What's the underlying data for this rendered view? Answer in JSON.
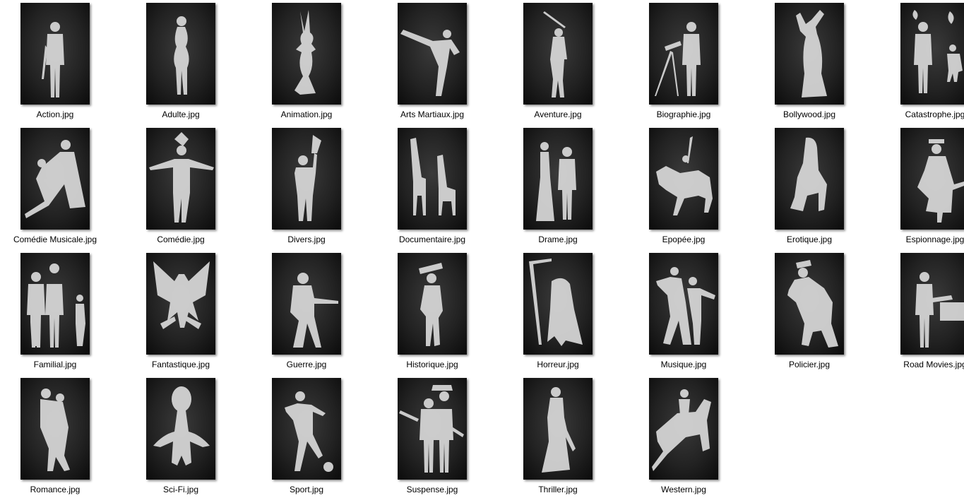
{
  "colors": {
    "background": "#ffffff",
    "thumbnail_dark": "#1c1c1c",
    "silhouette": "#d9d9d9",
    "label_text": "#000000"
  },
  "files": [
    {
      "name": "Action.jpg",
      "icon": "suited-man-silhouette-icon"
    },
    {
      "name": "Adulte.jpg",
      "icon": "woman-silhouette-icon"
    },
    {
      "name": "Animation.jpg",
      "icon": "cartoon-rabbit-silhouette-icon"
    },
    {
      "name": "Arts Martiaux.jpg",
      "icon": "karate-kick-silhouette-icon"
    },
    {
      "name": "Aventure.jpg",
      "icon": "swashbuckler-silhouette-icon"
    },
    {
      "name": "Biographie.jpg",
      "icon": "man-with-telescope-silhouette-icon"
    },
    {
      "name": "Bollywood.jpg",
      "icon": "dancer-silhouette-icon"
    },
    {
      "name": "Catastrophe.jpg",
      "icon": "fleeing-people-silhouette-icon"
    },
    {
      "name": "Comédie Musicale.jpg",
      "icon": "dancing-couple-silhouette-icon"
    },
    {
      "name": "Comédie.jpg",
      "icon": "jester-silhouette-icon"
    },
    {
      "name": "Divers.jpg",
      "icon": "man-raising-object-silhouette-icon"
    },
    {
      "name": "Documentaire.jpg",
      "icon": "giraffes-silhouette-icon"
    },
    {
      "name": "Drame.jpg",
      "icon": "couple-standing-silhouette-icon"
    },
    {
      "name": "Epopée.jpg",
      "icon": "knight-on-horse-silhouette-icon"
    },
    {
      "name": "Erotique.jpg",
      "icon": "crouching-woman-silhouette-icon"
    },
    {
      "name": "Espionnage.jpg",
      "icon": "spy-with-gun-silhouette-icon"
    },
    {
      "name": "Familial.jpg",
      "icon": "family-silhouette-icon"
    },
    {
      "name": "Fantastique.jpg",
      "icon": "dragon-silhouette-icon"
    },
    {
      "name": "Guerre.jpg",
      "icon": "soldier-with-rifle-silhouette-icon"
    },
    {
      "name": "Historique.jpg",
      "icon": "napoleon-silhouette-icon"
    },
    {
      "name": "Horreur.jpg",
      "icon": "grim-reaper-silhouette-icon"
    },
    {
      "name": "Musique.jpg",
      "icon": "musicians-silhouette-icon"
    },
    {
      "name": "Policier.jpg",
      "icon": "detective-with-pipe-silhouette-icon"
    },
    {
      "name": "Road Movies.jpg",
      "icon": "hitchhiker-silhouette-icon"
    },
    {
      "name": "Romance.jpg",
      "icon": "embracing-couple-silhouette-icon"
    },
    {
      "name": "Sci-Fi.jpg",
      "icon": "alien-silhouette-icon"
    },
    {
      "name": "Sport.jpg",
      "icon": "footballer-silhouette-icon"
    },
    {
      "name": "Suspense.jpg",
      "icon": "gangsters-silhouette-icon"
    },
    {
      "name": "Thriller.jpg",
      "icon": "woman-with-knife-silhouette-icon"
    },
    {
      "name": "Western.jpg",
      "icon": "bucking-horse-silhouette-icon"
    }
  ]
}
